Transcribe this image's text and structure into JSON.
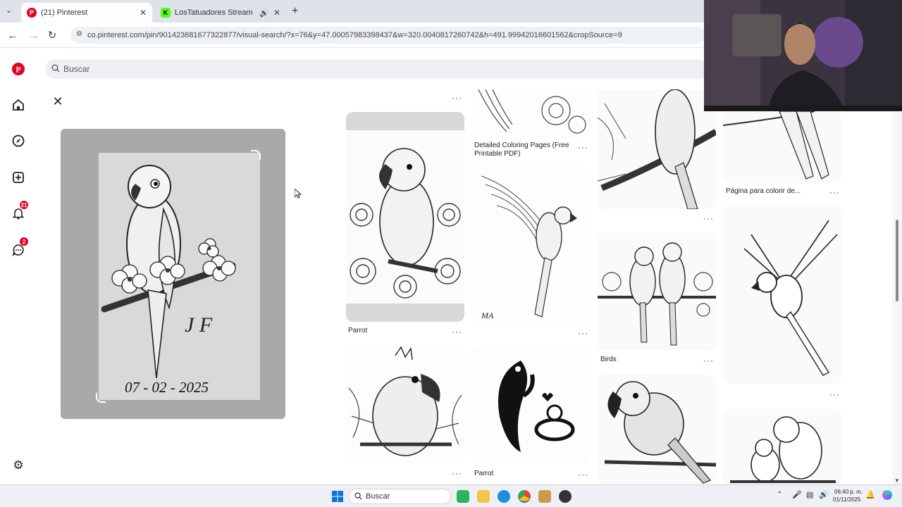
{
  "browser": {
    "tabs": [
      {
        "label": "(21) Pinterest",
        "favicon": "pinterest-icon",
        "active": true
      },
      {
        "label": "LosTatuadores Stream - Watch Li",
        "favicon": "kick-icon",
        "active": false
      }
    ],
    "url": "co.pinterest.com/pin/901423681677322877/visual-search/?x=76&y=47.00057983398437&w=320.0040817260742&h=491.99942016601562&cropSource=9"
  },
  "search": {
    "placeholder": "Buscar"
  },
  "sidebar": {
    "notifications_badge": "21",
    "messages_badge": "2"
  },
  "main_pin": {
    "initials": "J F",
    "date": "07 - 02 - 2025"
  },
  "results": [
    {
      "caption": "Detailed Coloring Pages (Free Printable PDF)"
    },
    {
      "caption": "Parrot"
    },
    {
      "caption": "Birds"
    },
    {
      "caption": "Página para colorir de..."
    },
    {
      "caption": "Parrot"
    }
  ],
  "taskbar": {
    "search_label": "Buscar",
    "time": "06:40 p. m.",
    "date": "01/11/2025"
  },
  "colors": {
    "pinterest_red": "#e60023",
    "panel_gray": "#a9a9a9"
  }
}
